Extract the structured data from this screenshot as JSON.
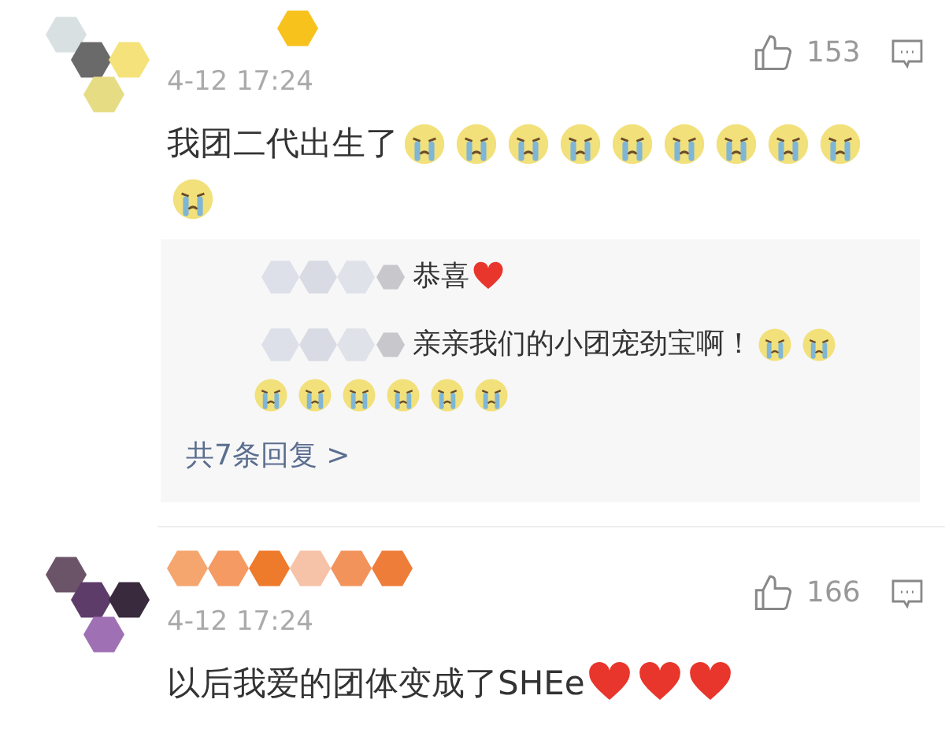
{
  "comments": [
    {
      "time": "4-12 17:24",
      "likes": "153",
      "content": [
        {
          "kind": "text",
          "text": "我团二代出生了"
        },
        {
          "kind": "cry"
        },
        {
          "kind": "cry"
        },
        {
          "kind": "cry"
        },
        {
          "kind": "cry"
        },
        {
          "kind": "cry"
        },
        {
          "kind": "cry"
        },
        {
          "kind": "cry"
        },
        {
          "kind": "cry"
        },
        {
          "kind": "cry"
        },
        {
          "kind": "cry"
        }
      ],
      "reply": {
        "content": [
          {
            "kind": "mosaic"
          },
          {
            "kind": "text",
            "text": "恭喜"
          },
          {
            "kind": "heart"
          },
          {
            "kind": "break"
          },
          {
            "kind": "mosaic"
          },
          {
            "kind": "text",
            "text": "亲亲我们的小团宠劲宝啊！"
          },
          {
            "kind": "cry"
          },
          {
            "kind": "cry"
          },
          {
            "kind": "cry"
          },
          {
            "kind": "cry"
          },
          {
            "kind": "cry"
          },
          {
            "kind": "cry"
          },
          {
            "kind": "cry"
          },
          {
            "kind": "cry"
          }
        ],
        "more": "共7条回复 >"
      }
    },
    {
      "time": "4-12 17:24",
      "likes": "166",
      "content": [
        {
          "kind": "text",
          "text": "以后我爱的团体变成了SHEe"
        },
        {
          "kind": "heart"
        },
        {
          "kind": "heart"
        },
        {
          "kind": "heart"
        }
      ]
    }
  ]
}
